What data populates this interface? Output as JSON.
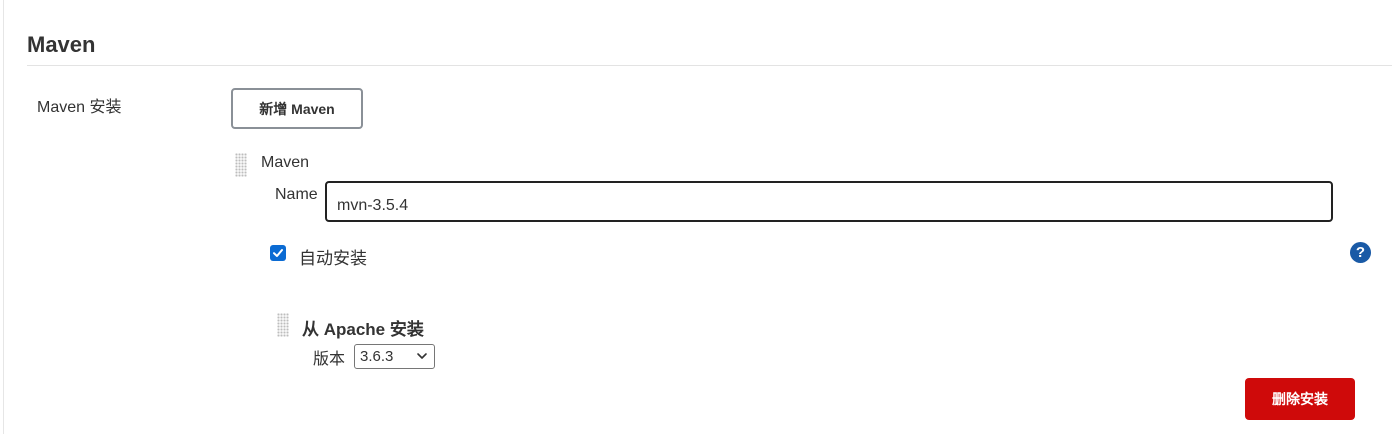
{
  "section": {
    "title": "Maven"
  },
  "maven_installations": {
    "label": "Maven 安装",
    "add_button_label": "新增 Maven"
  },
  "installation": {
    "title": "Maven",
    "name_label": "Name",
    "name_value": "mvn-3.5.4",
    "auto_install_label": "自动安装",
    "auto_install_checked": true,
    "help_icon": "question-mark-icon",
    "installer": {
      "title": "从 Apache 安装",
      "version_label": "版本",
      "version_selected": "3.6.3"
    },
    "delete_button_label": "删除安装"
  },
  "colors": {
    "delete_button": "#cf0a0a",
    "checkbox": "#0b6bd3",
    "help_icon": "#1a5aa6"
  }
}
